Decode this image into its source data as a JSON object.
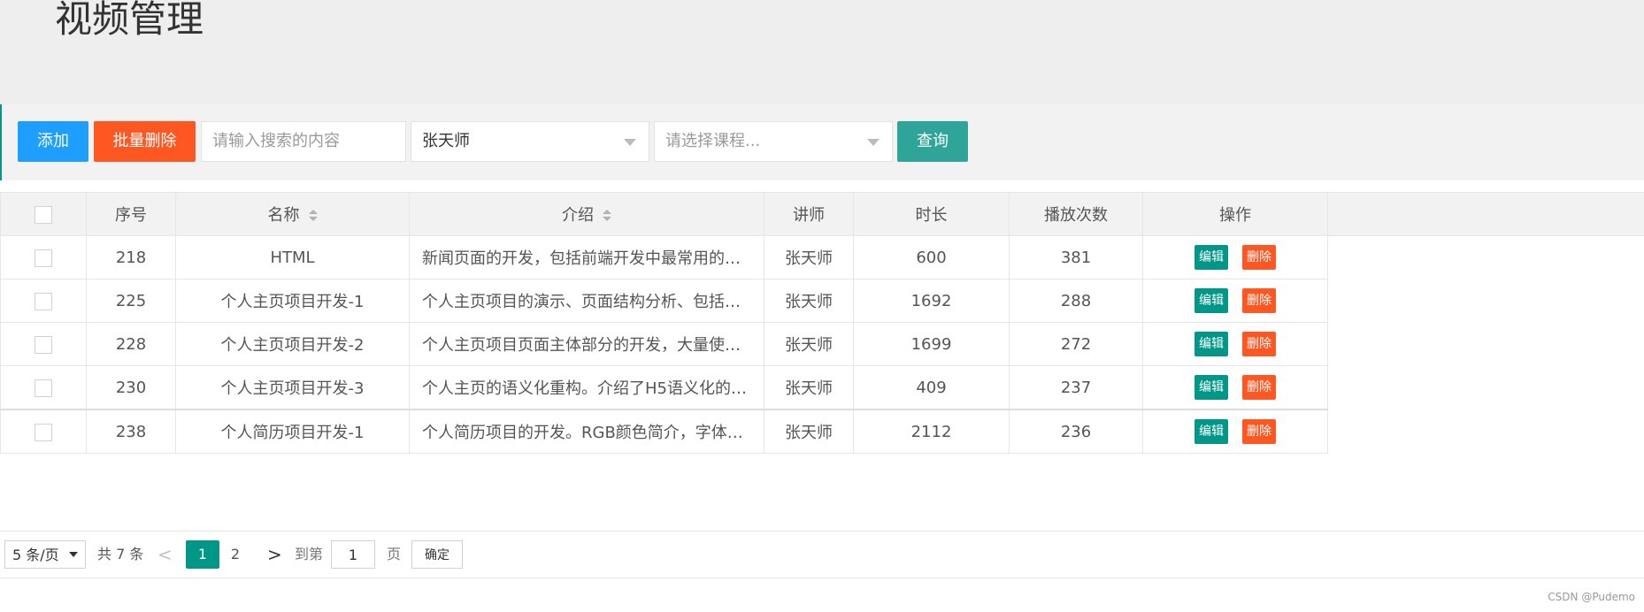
{
  "page": {
    "title": "视频管理"
  },
  "toolbar": {
    "add_label": "添加",
    "batch_delete_label": "批量删除",
    "search_placeholder": "请输入搜索的内容",
    "teacher_value": "张天师",
    "course_placeholder": "请选择课程...",
    "query_label": "查询"
  },
  "table": {
    "headers": [
      "序号",
      "名称",
      "介绍",
      "讲师",
      "时长",
      "播放次数",
      "操作"
    ],
    "rows": [
      {
        "id": "218",
        "name": "HTML",
        "intro": "新闻页面的开发，包括前端开发中最常用的…",
        "teacher": "张天师",
        "duration": "600",
        "plays": "381"
      },
      {
        "id": "225",
        "name": "个人主页项目开发-1",
        "intro": "个人主页项目的演示、页面结构分析、包括…",
        "teacher": "张天师",
        "duration": "1692",
        "plays": "288"
      },
      {
        "id": "228",
        "name": "个人主页项目开发-2",
        "intro": "个人主页项目页面主体部分的开发，大量使…",
        "teacher": "张天师",
        "duration": "1699",
        "plays": "272"
      },
      {
        "id": "230",
        "name": "个人主页项目开发-3",
        "intro": "个人主页的语义化重构。介绍了H5语义化的…",
        "teacher": "张天师",
        "duration": "409",
        "plays": "237"
      },
      {
        "id": "238",
        "name": "个人简历项目开发-1",
        "intro": "个人简历项目的开发。RGB颜色简介，字体…",
        "teacher": "张天师",
        "duration": "2112",
        "plays": "236"
      }
    ],
    "edit_label": "编辑",
    "delete_label": "删除"
  },
  "pager": {
    "limit": "5 条/页",
    "count": "共 7 条",
    "prev": "<",
    "current": "1",
    "page2": "2",
    "next": ">",
    "goto": "到第",
    "goto_value": "1",
    "unit": "页",
    "confirm": "确定"
  },
  "footer": {
    "watermark": "CSDN @Pudemo"
  },
  "colors": {
    "primary": "#009688",
    "blue": "#1e9fff",
    "danger": "#ff5722",
    "query": "#2fa599"
  },
  "icons": {
    "sort": "sort-icon",
    "caret": "caret-down-icon"
  }
}
